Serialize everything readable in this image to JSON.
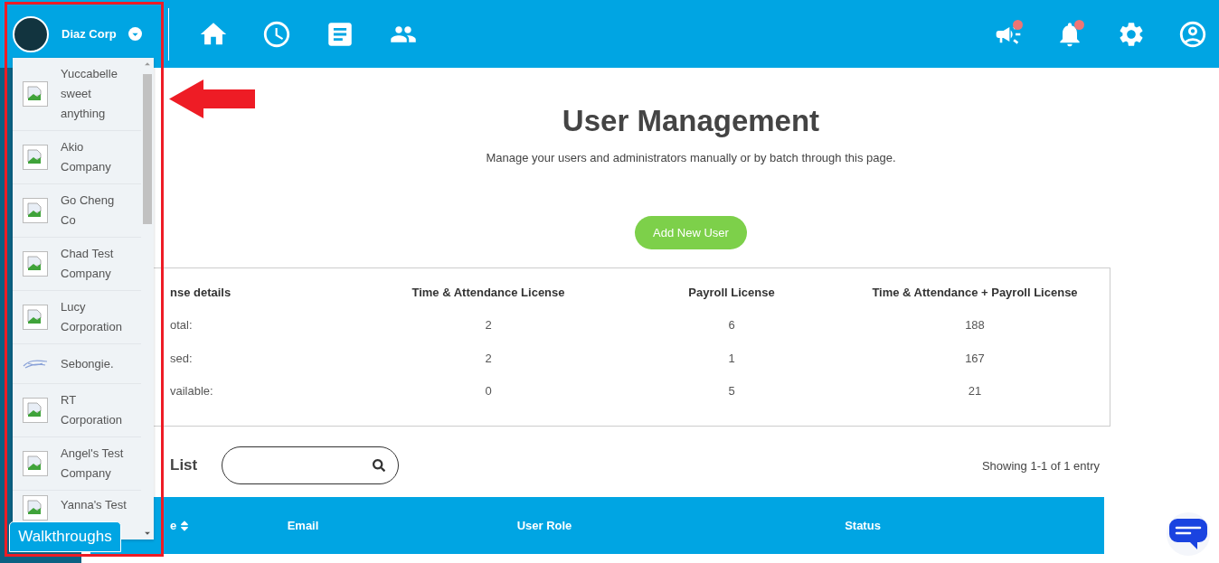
{
  "header": {
    "company": "Diaz Corp",
    "nav": [
      {
        "kind": "home"
      },
      {
        "kind": "clock"
      },
      {
        "kind": "document"
      },
      {
        "kind": "people"
      }
    ],
    "actions": [
      {
        "kind": "megaphone",
        "alert": true
      },
      {
        "kind": "bell",
        "alert": true
      },
      {
        "kind": "settings",
        "alert": false
      },
      {
        "kind": "profile",
        "alert": false
      }
    ]
  },
  "company_menu": {
    "items": [
      {
        "kind": "broken-image",
        "label": "Yuccabelle sweet anything"
      },
      {
        "kind": "broken-image",
        "label": "Akio Company"
      },
      {
        "kind": "broken-image",
        "label": "Go Cheng Co"
      },
      {
        "kind": "broken-image",
        "label": "Chad Test Company"
      },
      {
        "kind": "broken-image",
        "label": "Lucy Corporation"
      },
      {
        "kind": "logo",
        "label": "Sebongie."
      },
      {
        "kind": "broken-image",
        "label": "RT Corporation"
      },
      {
        "kind": "broken-image",
        "label": "Angel's Test Company"
      },
      {
        "kind": "broken-image",
        "label": "Yanna's Test"
      }
    ]
  },
  "walkthroughs_button": "Walkthroughs",
  "page": {
    "title": "User Management",
    "subtitle": "Manage your users and administrators manually or by batch through this page.",
    "add_button": "Add New User"
  },
  "license_table": {
    "columns": [
      "nse details",
      "Time & Attendance License",
      "Payroll License",
      "Time & Attendance + Payroll License"
    ],
    "rows": [
      [
        "otal:",
        "2",
        "6",
        "188"
      ],
      [
        "sed:",
        "2",
        "1",
        "167"
      ],
      [
        "vailable:",
        "0",
        "5",
        "21"
      ]
    ]
  },
  "user_list": {
    "title": "List",
    "count": "Showing 1-1 of 1 entry",
    "columns": [
      {
        "label": "e",
        "sortable": true
      },
      {
        "label": "Email",
        "sortable": false
      },
      {
        "label": "User Role",
        "sortable": false
      },
      {
        "label": "Status",
        "sortable": false
      }
    ]
  }
}
